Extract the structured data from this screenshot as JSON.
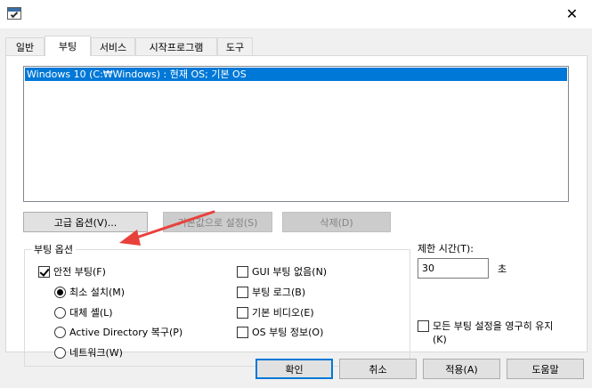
{
  "tabs": [
    "일반",
    "부팅",
    "서비스",
    "시작프로그램",
    "도구"
  ],
  "active_tab": "부팅",
  "os_list": [
    "Windows 10 (C:₩Windows) : 현재 OS; 기본 OS"
  ],
  "buttons": {
    "advanced": "고급 옵션(V)...",
    "set_default": "기본값으로 설정(S)",
    "delete": "삭제(D)",
    "ok": "확인",
    "cancel": "취소",
    "apply": "적용(A)",
    "help": "도움말"
  },
  "boot_options": {
    "title": "부팅 옵션",
    "safe_boot": "안전 부팅(F)",
    "minimal": "최소 설치(M)",
    "alternate_shell": "대체 셸(L)",
    "ad_repair": "Active Directory 복구(P)",
    "network": "네트워크(W)",
    "no_gui_boot": "GUI 부팅 없음(N)",
    "boot_log": "부팅 로그(B)",
    "base_video": "기본 비디오(E)",
    "os_boot_info": "OS 부팅 정보(O)"
  },
  "timeout": {
    "label": "제한 시간(T):",
    "value": "30",
    "unit": "초"
  },
  "make_permanent": {
    "line1": "모든 부팅 설정을 영구히 유지",
    "line2": "(K)"
  },
  "colors": {
    "selection": "#0078d7",
    "annotation_arrow": "#e8413c"
  }
}
